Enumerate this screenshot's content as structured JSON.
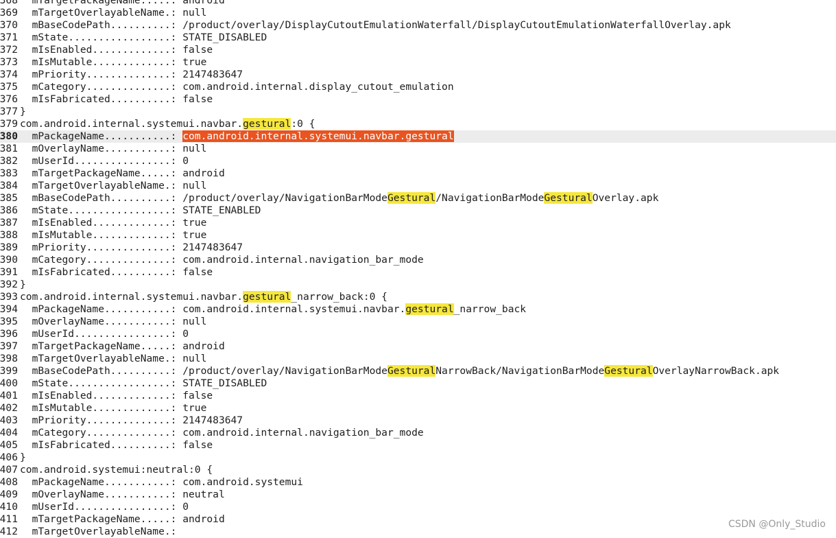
{
  "lines": [
    {
      "n": "368",
      "segs": [
        {
          "t": "  mTargetPackageName.....: android"
        }
      ]
    },
    {
      "n": "369",
      "segs": [
        {
          "t": "  mTargetOverlayableName.: null"
        }
      ]
    },
    {
      "n": "370",
      "segs": [
        {
          "t": "  mBaseCodePath..........: /product/overlay/DisplayCutoutEmulationWaterfall/DisplayCutoutEmulationWaterfallOverlay.apk"
        }
      ]
    },
    {
      "n": "371",
      "segs": [
        {
          "t": "  mState.................: STATE_DISABLED"
        }
      ]
    },
    {
      "n": "372",
      "segs": [
        {
          "t": "  mIsEnabled.............: false"
        }
      ]
    },
    {
      "n": "373",
      "segs": [
        {
          "t": "  mIsMutable.............: true"
        }
      ]
    },
    {
      "n": "374",
      "segs": [
        {
          "t": "  mPriority..............: 2147483647"
        }
      ]
    },
    {
      "n": "375",
      "segs": [
        {
          "t": "  mCategory..............: com.android.internal.display_cutout_emulation"
        }
      ]
    },
    {
      "n": "376",
      "segs": [
        {
          "t": "  mIsFabricated..........: false"
        }
      ]
    },
    {
      "n": "377",
      "segs": [
        {
          "t": "}"
        }
      ]
    },
    {
      "n": "379",
      "segs": [
        {
          "t": "com.android.internal.systemui.navbar."
        },
        {
          "t": "gestural",
          "hl": true
        },
        {
          "t": ":0 {"
        }
      ]
    },
    {
      "n": "380",
      "current": true,
      "segs": [
        {
          "t": "  mPackageName...........: "
        },
        {
          "t": "com.android.internal.systemui.navbar.gestural",
          "sel": true
        }
      ]
    },
    {
      "n": "381",
      "segs": [
        {
          "t": "  mOverlayName...........: null"
        }
      ]
    },
    {
      "n": "382",
      "segs": [
        {
          "t": "  mUserId................: 0"
        }
      ]
    },
    {
      "n": "383",
      "segs": [
        {
          "t": "  mTargetPackageName.....: android"
        }
      ]
    },
    {
      "n": "384",
      "segs": [
        {
          "t": "  mTargetOverlayableName.: null"
        }
      ]
    },
    {
      "n": "385",
      "segs": [
        {
          "t": "  mBaseCodePath..........: /product/overlay/NavigationBarMode"
        },
        {
          "t": "Gestural",
          "hl": true
        },
        {
          "t": "/NavigationBarMode"
        },
        {
          "t": "Gestural",
          "hl": true
        },
        {
          "t": "Overlay.apk"
        }
      ]
    },
    {
      "n": "386",
      "segs": [
        {
          "t": "  mState.................: STATE_ENABLED"
        }
      ]
    },
    {
      "n": "387",
      "segs": [
        {
          "t": "  mIsEnabled.............: true"
        }
      ]
    },
    {
      "n": "388",
      "segs": [
        {
          "t": "  mIsMutable.............: true"
        }
      ]
    },
    {
      "n": "389",
      "segs": [
        {
          "t": "  mPriority..............: 2147483647"
        }
      ]
    },
    {
      "n": "390",
      "segs": [
        {
          "t": "  mCategory..............: com.android.internal.navigation_bar_mode"
        }
      ]
    },
    {
      "n": "391",
      "segs": [
        {
          "t": "  mIsFabricated..........: false"
        }
      ]
    },
    {
      "n": "392",
      "segs": [
        {
          "t": "}"
        }
      ]
    },
    {
      "n": "393",
      "segs": [
        {
          "t": "com.android.internal.systemui.navbar."
        },
        {
          "t": "gestural",
          "hl": true
        },
        {
          "t": "_narrow_back:0 {"
        }
      ]
    },
    {
      "n": "394",
      "segs": [
        {
          "t": "  mPackageName...........: com.android.internal.systemui.navbar."
        },
        {
          "t": "gestural",
          "hl": true
        },
        {
          "t": "_narrow_back"
        }
      ]
    },
    {
      "n": "395",
      "segs": [
        {
          "t": "  mOverlayName...........: null"
        }
      ]
    },
    {
      "n": "396",
      "segs": [
        {
          "t": "  mUserId................: 0"
        }
      ]
    },
    {
      "n": "397",
      "segs": [
        {
          "t": "  mTargetPackageName.....: android"
        }
      ]
    },
    {
      "n": "398",
      "segs": [
        {
          "t": "  mTargetOverlayableName.: null"
        }
      ]
    },
    {
      "n": "399",
      "segs": [
        {
          "t": "  mBaseCodePath..........: /product/overlay/NavigationBarMode"
        },
        {
          "t": "Gestural",
          "hl": true
        },
        {
          "t": "NarrowBack/NavigationBarMode"
        },
        {
          "t": "Gestural",
          "hl": true
        },
        {
          "t": "OverlayNarrowBack.apk"
        }
      ]
    },
    {
      "n": "400",
      "segs": [
        {
          "t": "  mState.................: STATE_DISABLED"
        }
      ]
    },
    {
      "n": "401",
      "segs": [
        {
          "t": "  mIsEnabled.............: false"
        }
      ]
    },
    {
      "n": "402",
      "segs": [
        {
          "t": "  mIsMutable.............: true"
        }
      ]
    },
    {
      "n": "403",
      "segs": [
        {
          "t": "  mPriority..............: 2147483647"
        }
      ]
    },
    {
      "n": "404",
      "segs": [
        {
          "t": "  mCategory..............: com.android.internal.navigation_bar_mode"
        }
      ]
    },
    {
      "n": "405",
      "segs": [
        {
          "t": "  mIsFabricated..........: false"
        }
      ]
    },
    {
      "n": "406",
      "segs": [
        {
          "t": "}"
        }
      ]
    },
    {
      "n": "407",
      "segs": [
        {
          "t": "com.android.systemui:neutral:0 {"
        }
      ]
    },
    {
      "n": "408",
      "segs": [
        {
          "t": "  mPackageName...........: com.android.systemui"
        }
      ]
    },
    {
      "n": "409",
      "segs": [
        {
          "t": "  mOverlayName...........: neutral"
        }
      ]
    },
    {
      "n": "410",
      "segs": [
        {
          "t": "  mUserId................: 0"
        }
      ]
    },
    {
      "n": "411",
      "segs": [
        {
          "t": "  mTargetPackageName.....: android"
        }
      ]
    },
    {
      "n": "412",
      "segs": [
        {
          "t": "  mTargetOverlayableName.:"
        }
      ]
    }
  ],
  "watermark": "CSDN @Only_Studio",
  "colors": {
    "search_highlight": "#f6e73c",
    "selection": "#e95420",
    "current_line": "#ececec"
  }
}
